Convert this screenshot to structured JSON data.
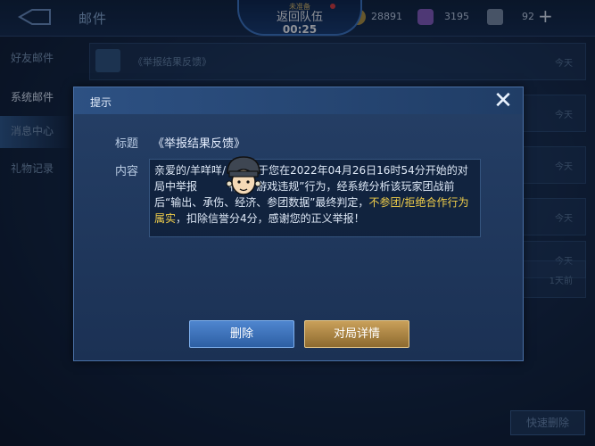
{
  "topbar": {
    "title": "邮件",
    "team_status": "未准备",
    "team_return": "返回队伍",
    "team_timer": "00:25",
    "gold": "28891",
    "gems": "3195",
    "stamina": "92",
    "add_icon": "+"
  },
  "sidebar": {
    "items": [
      {
        "label": "好友邮件"
      },
      {
        "label": "系统邮件"
      },
      {
        "label": "消息中心"
      },
      {
        "label": "礼物记录"
      }
    ]
  },
  "mail_list": {
    "rows": [
      {
        "title": "《举报结果反馈》",
        "date": "今天"
      },
      {
        "title": "",
        "date": "今天"
      },
      {
        "title": "",
        "date": "今天"
      },
      {
        "title": "",
        "date": "今天"
      },
      {
        "title": "",
        "date": "今天"
      },
      {
        "title": "",
        "date": "1天前"
      }
    ],
    "quick_delete": "快速删除"
  },
  "dialog": {
    "title": "提示",
    "close_icon": "✕",
    "subject_label": "标题",
    "subject_value": "《举报结果反馈》",
    "content_label": "内容",
    "content_part1": "亲爱的/羊咩咩/",
    "content_part2": "关于您在2022年04月26日16时54分开始的对局中举报",
    "content_part3": "存在“游戏违规”行为，经系统分析该玩家团战前后“输出、承伤、经济、参团数据”最终判定，",
    "content_highlight": "不参团/拒绝合作行为属实",
    "content_part4": "，扣除信誉分4分，感谢您的正义举报！",
    "delete_button": "删除",
    "detail_button": "对局详情"
  },
  "colors": {
    "accent_gold": "#f2cf4a",
    "button_blue": "#3b70b8",
    "button_gold": "#b08848"
  }
}
